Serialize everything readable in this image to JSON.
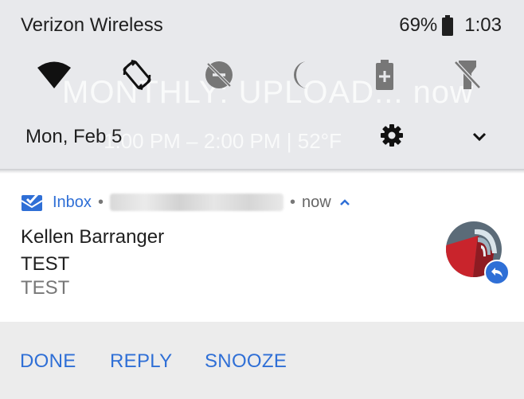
{
  "status_bar": {
    "carrier": "Verizon Wireless",
    "battery_percent": "69%",
    "time": "1:03"
  },
  "quick_settings": [
    {
      "name": "wifi-icon"
    },
    {
      "name": "auto-rotate-icon"
    },
    {
      "name": "data-saver-icon"
    },
    {
      "name": "do-not-disturb-icon"
    },
    {
      "name": "battery-saver-icon"
    },
    {
      "name": "flashlight-off-icon"
    }
  ],
  "shade": {
    "date": "Mon, Feb 5",
    "ghost_title": "MONTHLY: UPLOAD... now",
    "ghost_time": "1:00 PM – 2:00 PM | 52°F"
  },
  "notification": {
    "app_name": "Inbox",
    "separator": "•",
    "when": "now",
    "sender": "Kellen Barranger",
    "subject": "TEST",
    "preview": "TEST"
  },
  "actions": {
    "done": "DONE",
    "reply": "REPLY",
    "snooze": "SNOOZE"
  },
  "colors": {
    "accent": "#2f6fd6",
    "shade_bg": "#e8e9ec",
    "actions_bg": "#ececec"
  }
}
